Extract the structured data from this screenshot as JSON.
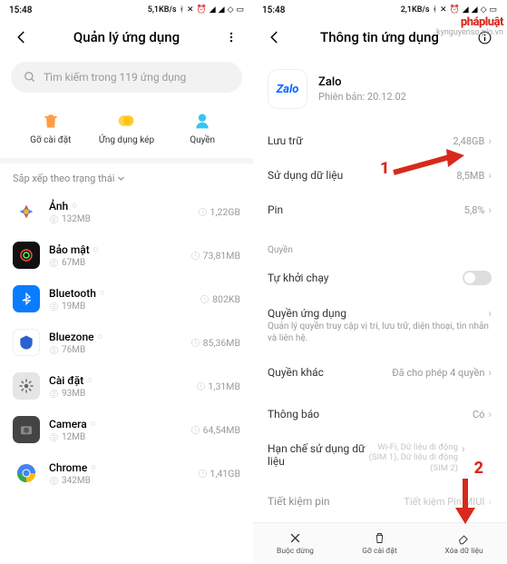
{
  "status": {
    "time": "15:48",
    "net1": "5,1KB/s",
    "net2": "2,1KB/s"
  },
  "left": {
    "title": "Quản lý ứng dụng",
    "search_placeholder": "Tìm kiếm trong 119 ứng dụng",
    "actions": {
      "uninstall": "Gỡ cài đặt",
      "dual": "Ứng dụng kép",
      "permissions": "Quyền"
    },
    "sort_label": "Sắp xếp theo trạng thái",
    "apps": [
      {
        "name": "Ảnh",
        "size": "132MB",
        "age": "1,22GB"
      },
      {
        "name": "Bảo mật",
        "size": "67MB",
        "age": "73,81MB"
      },
      {
        "name": "Bluetooth",
        "size": "19MB",
        "age": "802KB"
      },
      {
        "name": "Bluezone",
        "size": "76MB",
        "age": "85,36MB"
      },
      {
        "name": "Cài đặt",
        "size": "93MB",
        "age": "1,31MB"
      },
      {
        "name": "Camera",
        "size": "12MB",
        "age": "64,54MB"
      },
      {
        "name": "Chrome",
        "size": "342MB",
        "age": "1,41GB"
      }
    ]
  },
  "right": {
    "title": "Thông tin ứng dụng",
    "app_name": "Zalo",
    "version_label": "Phiên bản: 20.12.02",
    "storage": {
      "label": "Lưu trữ",
      "value": "2,48GB"
    },
    "data_usage": {
      "label": "Sử dụng dữ liệu",
      "value": "8,5MB"
    },
    "battery": {
      "label": "Pin",
      "value": "5,8%"
    },
    "perm_head": "Quyền",
    "autostart": "Tự khởi chạy",
    "app_perm": {
      "label": "Quyền ứng dụng",
      "sub": "Quản lý quyền truy cập vị trí, lưu trữ, diện thoại, tin nhắn và liên hệ."
    },
    "other_perm": {
      "label": "Quyền khác",
      "value": "Đã cho phép 4 quyền"
    },
    "notif": {
      "label": "Thông báo",
      "value": "Có"
    },
    "restrict": {
      "label": "Hạn chế sử dụng dữ liệu",
      "sub": "Wi-Fi, Dữ liệu di động (SIM 1), Dữ liệu di động (SIM 2)"
    },
    "save": {
      "label": "Tiết kiệm pin",
      "value": "Tiết kiệm Pin MIUI"
    },
    "bottom": {
      "forcestop": "Buộc dừng",
      "uninstall": "Gỡ cài đặt",
      "clear": "Xóa dữ liệu"
    }
  },
  "annotations": {
    "one": "1",
    "two": "2"
  },
  "watermark": {
    "main": "phápluật",
    "sub": "kynguyenso.plo.vn"
  }
}
